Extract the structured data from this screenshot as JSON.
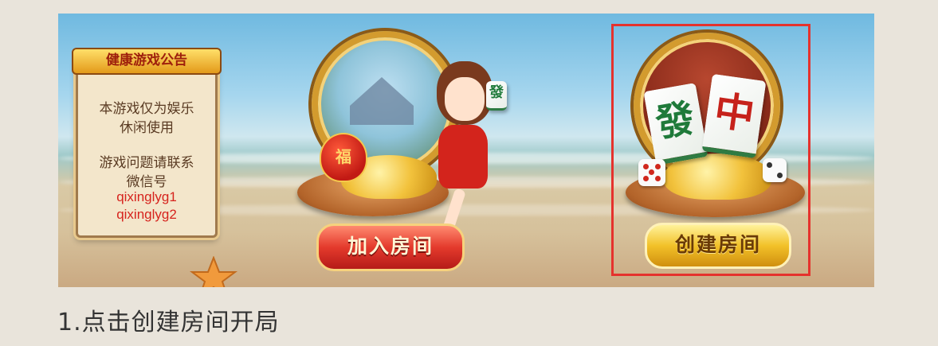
{
  "notice": {
    "title": "健康游戏公告",
    "line1": "本游戏仅为娱乐",
    "line2": "休闲使用",
    "line3": "游戏问题请联系",
    "line4": "微信号",
    "wechat1": "qixinglyg1",
    "wechat2": "qixinglyg2"
  },
  "buttons": {
    "join_room": "加入房间",
    "create_room": "创建房间"
  },
  "tiles": {
    "fa": "發",
    "zhong": "中"
  },
  "seal": "福",
  "caption": "1.点击创建房间开局",
  "colors": {
    "highlight": "#e5322d",
    "join_button": "#e43a2c",
    "create_button": "#f2c129"
  }
}
